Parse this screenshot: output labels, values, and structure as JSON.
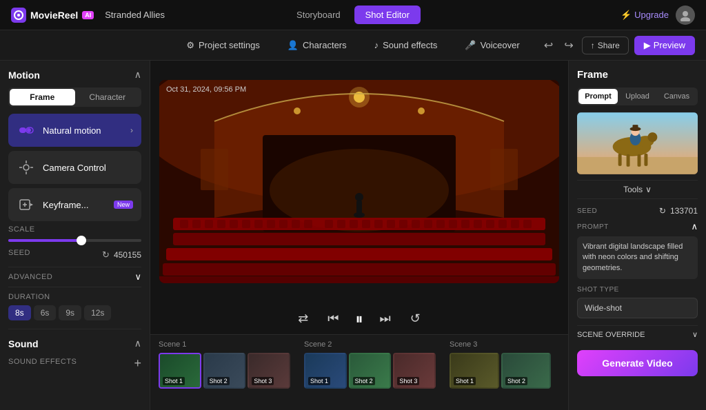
{
  "app": {
    "logo": "MovieReel",
    "logo_movie": "Movie",
    "logo_reel": "Reel",
    "logo_ai": "AI",
    "project_name": "Stranded Allies"
  },
  "top_nav": {
    "storyboard_label": "Storyboard",
    "shot_editor_label": "Shot Editor",
    "upgrade_label": "Upgrade"
  },
  "secondary_nav": {
    "project_settings_label": "Project settings",
    "characters_label": "Characters",
    "sound_effects_label": "Sound effects",
    "voiceover_label": "Voiceover",
    "share_label": "Share",
    "preview_label": "Preview"
  },
  "left_panel": {
    "motion_title": "Motion",
    "tab_frame": "Frame",
    "tab_character": "Character",
    "items": [
      {
        "id": "natural-motion",
        "label": "Natural motion",
        "active": true,
        "has_arrow": true
      },
      {
        "id": "camera-control",
        "label": "Camera Control",
        "active": false
      },
      {
        "id": "keyframe",
        "label": "Keyframe...",
        "active": false,
        "badge": "New"
      }
    ],
    "scale_label": "SCALE",
    "scale_value": 55,
    "seed_label": "SEED",
    "seed_value": "450155",
    "advanced_label": "ADVANCED",
    "duration_label": "DURATION",
    "duration_options": [
      "8s",
      "6s",
      "9s",
      "12s"
    ],
    "duration_active": "8s",
    "sound_title": "Sound",
    "sound_effects_label": "SOUND EFFECTS"
  },
  "video": {
    "timestamp": "Oct 31, 2024, 09:56 PM"
  },
  "timeline": {
    "scenes": [
      {
        "label": "Scene 1",
        "shots": [
          {
            "id": "s1-shot1",
            "label": "Shot 1",
            "active": true,
            "color": "#2a6a4a"
          },
          {
            "id": "s1-shot2",
            "label": "Shot 2",
            "active": false,
            "color": "#3a4a5a"
          },
          {
            "id": "s1-shot3",
            "label": "Shot 3",
            "active": false,
            "color": "#4a3a3a"
          }
        ]
      },
      {
        "label": "Scene 2",
        "shots": [
          {
            "id": "s2-shot1",
            "label": "Shot 1",
            "active": false,
            "color": "#2a4a6a"
          },
          {
            "id": "s2-shot2",
            "label": "Shot 2",
            "active": false,
            "color": "#3a6a4a"
          },
          {
            "id": "s2-shot3",
            "label": "Shot 3",
            "active": false,
            "color": "#5a3a3a"
          }
        ]
      },
      {
        "label": "Scene 3",
        "shots": [
          {
            "id": "s3-shot1",
            "label": "Shot 1",
            "active": false,
            "color": "#4a4a2a"
          },
          {
            "id": "s3-shot2",
            "label": "Shot 2",
            "active": false,
            "color": "#3a5a4a"
          }
        ]
      }
    ]
  },
  "right_panel": {
    "frame_title": "Frame",
    "tab_prompt": "Prompt",
    "tab_upload": "Upload",
    "tab_canvas": "Canvas",
    "tools_label": "Tools",
    "seed_label": "SEED",
    "seed_value": "133701",
    "prompt_label": "PROMPT",
    "prompt_text": "Vibrant digital landscape filled with neon colors and shifting geometries.",
    "shot_type_label": "SHOT TYPE",
    "shot_type_value": "Wide-shot",
    "scene_override_label": "SCENE OVERRIDE",
    "generate_label": "Generate Video"
  },
  "icons": {
    "shuffle": "⇄",
    "prev": "⏮",
    "play": "⏸",
    "next": "⏭",
    "repeat": "↺",
    "chevron_down": "⌄",
    "chevron_up": "⌃",
    "refresh": "↻",
    "share": "↑",
    "play_btn": "▶",
    "bolt": "⚡",
    "settings": "⚙",
    "music": "♪",
    "mic": "🎤",
    "plus": "+"
  }
}
